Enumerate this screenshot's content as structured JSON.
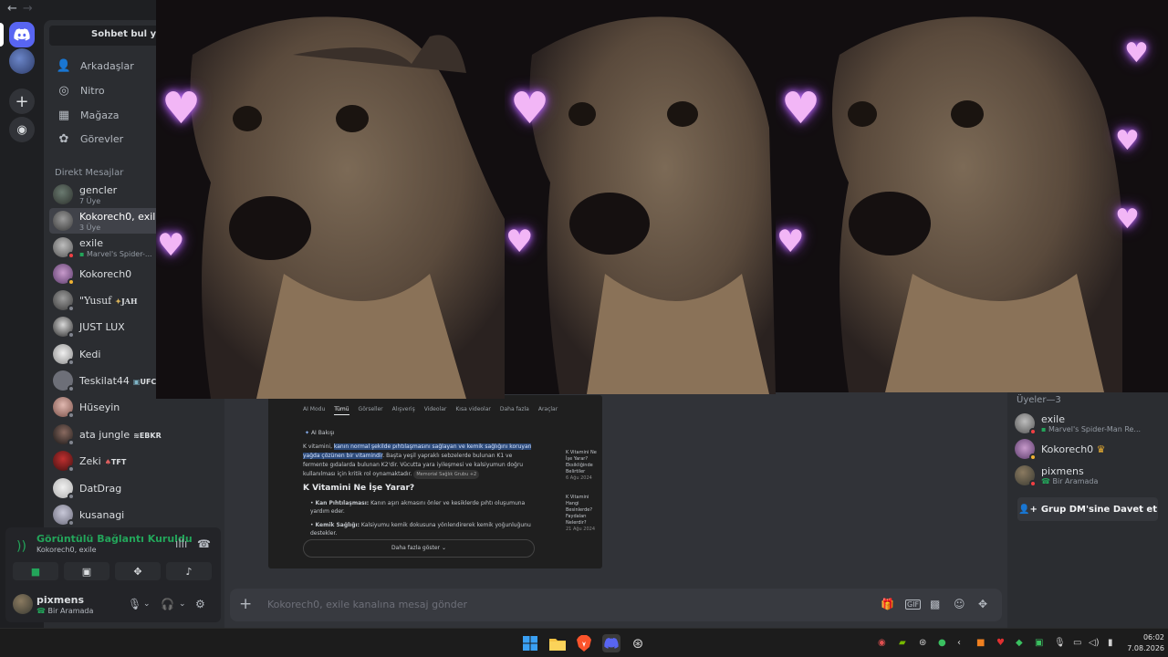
{
  "sidebar": {
    "find_placeholder": "Sohbet bul ya da b",
    "nav": [
      {
        "label": "Arkadaşlar",
        "icon": "friends-icon"
      },
      {
        "label": "Nitro",
        "icon": "nitro-icon"
      },
      {
        "label": "Mağaza",
        "icon": "shop-icon"
      },
      {
        "label": "Görevler",
        "icon": "quests-icon"
      }
    ],
    "dm_header": "Direkt Mesajlar",
    "dms": [
      {
        "name": "gencler",
        "sub": "7 Üye",
        "tag": ""
      },
      {
        "name": "Kokorech0, exile",
        "sub": "3 Üye",
        "tag": ""
      },
      {
        "name": "exile",
        "sub": "Marvel's Spider-...",
        "tag": ""
      },
      {
        "name": "Kokorech0",
        "sub": "",
        "tag": ""
      },
      {
        "name": "\"Yusuf",
        "sub": "",
        "tag": "JAH"
      },
      {
        "name": "JUST LUX",
        "sub": "",
        "tag": ""
      },
      {
        "name": "Kedi",
        "sub": "",
        "tag": ""
      },
      {
        "name": "Teskilat44",
        "sub": "",
        "tag": "UFC"
      },
      {
        "name": "Hüseyin",
        "sub": "",
        "tag": ""
      },
      {
        "name": "ata jungle",
        "sub": "",
        "tag": "EBKR"
      },
      {
        "name": "Zeki",
        "sub": "",
        "tag": "TFT"
      },
      {
        "name": "DatDrag",
        "sub": "",
        "tag": ""
      },
      {
        "name": "kusanagi",
        "sub": "",
        "tag": ""
      }
    ]
  },
  "voice": {
    "title": "Görüntülü Bağlantı Kuruldu",
    "channel": "Kokorech0, exile"
  },
  "user": {
    "name": "pixmens",
    "status": "Bir Aramada"
  },
  "shared_screen": {
    "tabs": [
      "AI Modu",
      "Tümü",
      "Görseller",
      "Alışveriş",
      "Videolar",
      "Kısa videolar",
      "Daha fazla",
      "Araçlar"
    ],
    "ai_label": "AI Bakışı",
    "para_prefix": "K vitamini, ",
    "para_highlight": "kanın normal şekilde pıhtılaşmasını sağlayan ve kemik sağlığını koruyan yağda çözünen bir vitamindir",
    "para_rest": ". Başta yeşil yapraklı sebzelerde bulunan K1 ve fermente gıdalarda bulunan K2'dir. Vücutta yara iyileşmesi ve kalsiyumun doğru kullanılması için kritik rol oynamaktadır.",
    "para_source": "Memorial Sağlık Grubu +2",
    "heading": "K Vitamini Ne İşe Yarar?",
    "bullet1_bold": "Kan Pıhtılaşması:",
    "bullet1": " Kanın aşırı akmasını önler ve kesiklerde pıhtı oluşumuna yardım eder.",
    "bullet2_bold": "Kemik Sağlığı:",
    "bullet2": " Kalsiyumu kemik dokusuna yönlendirerek kemik yoğunluğunu destekler.",
    "more": "Daha fazla göster",
    "side1": "K Vitamini Ne İşe Yarar? Eksikliğinde Belirtiler",
    "side1_date": "6 Ağu 2024",
    "side2": "K Vitamini Hangi Besinlerde? Faydaları Nelerdir?",
    "side2_date": "21 Ağu 2024"
  },
  "message_placeholder": "Kokorech0, exile kanalına mesaj gönder",
  "members": {
    "header": "Üyeler—3",
    "list": [
      {
        "name": "exile",
        "sub": "Marvel's Spider-Man Re...",
        "status": "dnd",
        "crown": false
      },
      {
        "name": "Kokorech0",
        "sub": "",
        "status": "idle",
        "crown": true
      },
      {
        "name": "pixmens",
        "sub": "Bir Aramada",
        "status": "dnd",
        "crown": false
      }
    ],
    "invite": "Grup DM'sine Davet et"
  },
  "taskbar": {
    "time": "06:02",
    "date": "7.08.2026"
  },
  "colors": {
    "online_green": "#23a55a",
    "dnd_red": "#f23f43",
    "idle_yellow": "#f0b232",
    "blurple": "#5865f2"
  }
}
